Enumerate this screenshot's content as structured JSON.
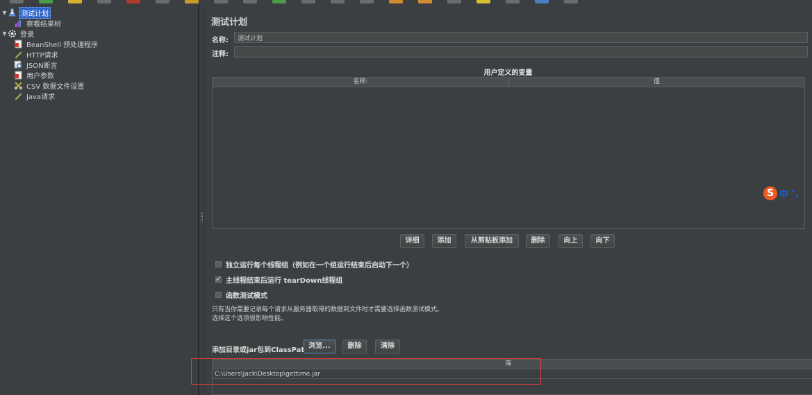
{
  "toolbar": {
    "buttons": [
      "#6a6d6f",
      "#4b9b4b",
      "#d4b030",
      "#6a6d6f",
      "#b03a2e",
      "#6a6d6f",
      "#c89a2a",
      "#6a6d6f",
      "#6a6d6f",
      "#4b9b4b",
      "#6a6d6f",
      "#6a6d6f",
      "#6a6d6f",
      "#d08a30",
      "#d08a30",
      "#6a6d6f",
      "#d4c030",
      "#6a6d6f",
      "#4a7fc0",
      "#6a6d6f"
    ]
  },
  "tree": {
    "items": [
      {
        "label": "测试计划",
        "icon": "flask-icon",
        "indent": 0,
        "expanded": true,
        "selected": true
      },
      {
        "label": "察看结果树",
        "icon": "chart-icon",
        "indent": 1
      },
      {
        "label": "登录",
        "icon": "gear-icon",
        "indent": 1,
        "expanded": true
      },
      {
        "label": "BeanShell 预处理程序",
        "icon": "script-icon",
        "indent": 2
      },
      {
        "label": "HTTP请求",
        "icon": "pen-icon",
        "indent": 2
      },
      {
        "label": "JSON断言",
        "icon": "magnifier-icon",
        "indent": 2
      },
      {
        "label": "用户参数",
        "icon": "script-icon",
        "indent": 2
      },
      {
        "label": "CSV 数据文件设置",
        "icon": "scissors-icon",
        "indent": 2
      },
      {
        "label": "Java请求",
        "icon": "pen-icon",
        "indent": 2
      }
    ]
  },
  "main": {
    "title": "测试计划",
    "name_label": "名称:",
    "name_value": "测试计划",
    "comment_label": "注释:",
    "comment_value": "",
    "udv_title": "用户定义的变量",
    "udv_columns": [
      "名称:",
      "值"
    ],
    "udv_buttons": [
      "详细",
      "添加",
      "从剪贴板添加",
      "删除",
      "向上",
      "向下"
    ],
    "options": [
      {
        "label": "独立运行每个线程组（例如在一个组运行结束后启动下一个）",
        "checked": false
      },
      {
        "label": "主线程结束后运行 tearDown线程组",
        "checked": true
      },
      {
        "label": "函数测试模式",
        "checked": false
      }
    ],
    "help_lines": [
      "只有当你需要记录每个请求从服务器取得的数据到文件时才需要选择函数测试模式。",
      "选择这个选项很影响性能。"
    ],
    "classpath_label": "添加目录或jar包到ClassPath",
    "classpath_buttons": [
      "浏览...",
      "删除",
      "清除"
    ],
    "lib_column": "库",
    "lib_rows": [
      "C:\\Users\\Jack\\Desktop\\gettime.jar"
    ]
  },
  "ime": {
    "logo": "S",
    "mode": "中",
    "punct": "°,"
  },
  "colors": {
    "background": "#3c3f41",
    "selection": "#2f65ca",
    "highlight_border": "#e53935"
  }
}
